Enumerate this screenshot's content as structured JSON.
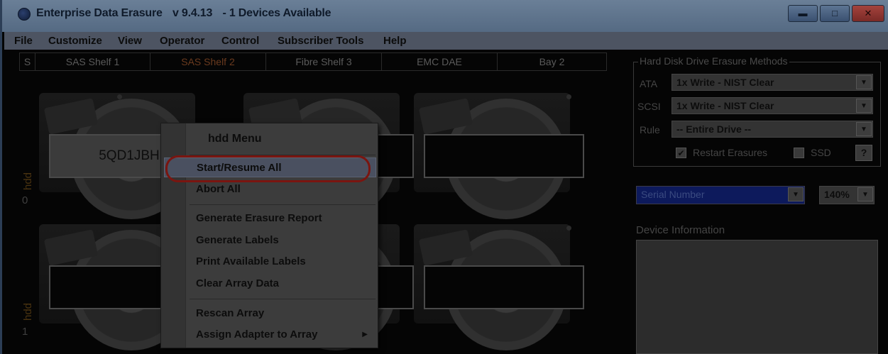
{
  "titlebar": {
    "app_name": "Enterprise Data Erasure",
    "version": "v 9.4.13",
    "status": "- 1 Devices Available",
    "min_symbol": "▬",
    "max_symbol": "□",
    "close_symbol": "✕"
  },
  "menubar": [
    "File",
    "Customize",
    "View",
    "Operator",
    "Control",
    "Subscriber Tools",
    "Help"
  ],
  "tabs": [
    {
      "label": "S",
      "active": false
    },
    {
      "label": "SAS Shelf 1",
      "active": false
    },
    {
      "label": "SAS Shelf 2",
      "active": true
    },
    {
      "label": "Fibre Shelf 3",
      "active": false
    },
    {
      "label": "EMC DAE",
      "active": false
    },
    {
      "label": "Bay 2",
      "active": false
    }
  ],
  "rows": [
    {
      "type": "hdd",
      "index": "0"
    },
    {
      "type": "hdd",
      "index": "1"
    }
  ],
  "drives": [
    {
      "serial": "5QD1JBH"
    }
  ],
  "context_menu": {
    "header": "hdd Menu",
    "items": {
      "start_resume_all": "Start/Resume All",
      "abort_all": "Abort All",
      "generate_erasure_report": "Generate Erasure Report",
      "generate_labels": "Generate Labels",
      "print_available_labels": "Print Available Labels",
      "clear_array_data": "Clear Array Data",
      "rescan_array": "Rescan Array",
      "assign_adapter_to_array": "Assign Adapter to Array"
    },
    "submenu_arrow": "▶"
  },
  "erasure_methods": {
    "title": "Hard Disk Drive Erasure Methods",
    "ata_label": "ATA",
    "ata_value": "1x Write - NIST Clear",
    "scsi_label": "SCSI",
    "scsi_value": "1x Write - NIST Clear",
    "rule_label": "Rule",
    "rule_value": "-- Entire Drive --",
    "restart_erasures_label": "Restart Erasures",
    "restart_erasures_checked": true,
    "ssd_label": "SSD",
    "ssd_checked": false,
    "help_label": "?",
    "check_mark": "✔",
    "dropdown_arrow": "▼"
  },
  "display_field": {
    "value": "Serial Number"
  },
  "zoom": {
    "value": "140%"
  },
  "device_information": {
    "label": "Device Information"
  }
}
